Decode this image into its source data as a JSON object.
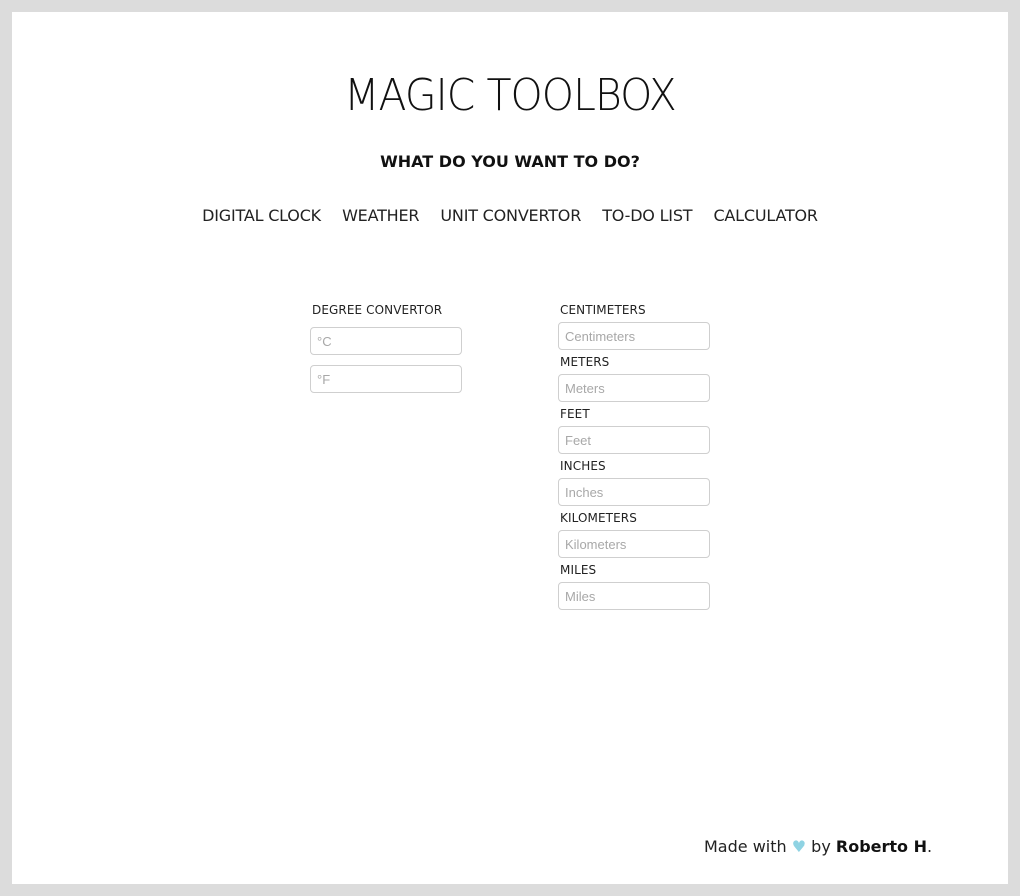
{
  "header": {
    "title": "MAGIC TOOLBOX",
    "subtitle": "WHAT DO YOU WANT TO DO?"
  },
  "nav": {
    "items": [
      {
        "label": "DIGITAL CLOCK"
      },
      {
        "label": "WEATHER"
      },
      {
        "label": "UNIT CONVERTOR"
      },
      {
        "label": "TO-DO LIST"
      },
      {
        "label": "CALCULATOR"
      }
    ]
  },
  "degree": {
    "label": "DEGREE CONVERTOR",
    "celsius_placeholder": "°C",
    "fahrenheit_placeholder": "°F"
  },
  "units": [
    {
      "label": "CENTIMETERS",
      "placeholder": "Centimeters"
    },
    {
      "label": "METERS",
      "placeholder": "Meters"
    },
    {
      "label": "FEET",
      "placeholder": "Feet"
    },
    {
      "label": "INCHES",
      "placeholder": "Inches"
    },
    {
      "label": "KILOMETERS",
      "placeholder": "Kilometers"
    },
    {
      "label": "MILES",
      "placeholder": "Miles"
    }
  ],
  "footer": {
    "made_with": "Made with",
    "heart": "♥",
    "by": "by",
    "author": "Roberto H",
    "end": "."
  },
  "colors": {
    "background": "#dcdcdc",
    "sheet": "#ffffff",
    "heart": "#8fd3e3"
  }
}
